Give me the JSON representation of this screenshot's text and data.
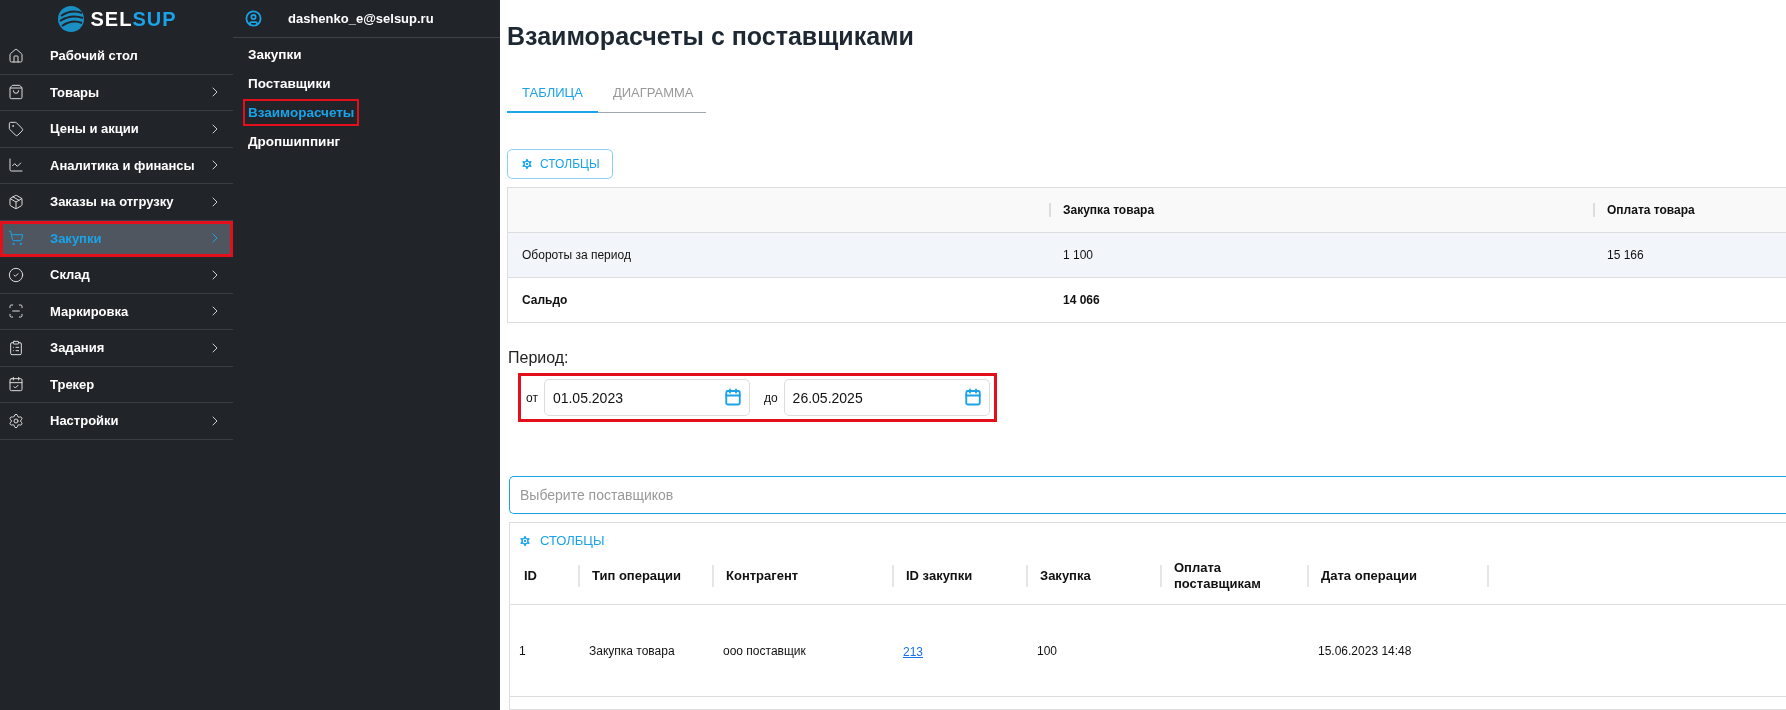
{
  "logo": {
    "part_1": "SEL",
    "part_2": "SUP"
  },
  "sidebar": {
    "items": [
      {
        "label": "Рабочий стол",
        "has_submenu": false,
        "selected": false,
        "highlighted": false
      },
      {
        "label": "Товары",
        "has_submenu": true,
        "selected": false,
        "highlighted": false
      },
      {
        "label": "Цены и акции",
        "has_submenu": true,
        "selected": false,
        "highlighted": false
      },
      {
        "label": "Аналитика и финансы",
        "has_submenu": true,
        "selected": false,
        "highlighted": false
      },
      {
        "label": "Заказы на отгрузку",
        "has_submenu": true,
        "selected": false,
        "highlighted": false
      },
      {
        "label": "Закупки",
        "has_submenu": true,
        "selected": true,
        "highlighted": true
      },
      {
        "label": "Склад",
        "has_submenu": true,
        "selected": false,
        "highlighted": false
      },
      {
        "label": "Маркировка",
        "has_submenu": true,
        "selected": false,
        "highlighted": false
      },
      {
        "label": "Задания",
        "has_submenu": true,
        "selected": false,
        "highlighted": false
      },
      {
        "label": "Трекер",
        "has_submenu": false,
        "selected": false,
        "highlighted": false
      },
      {
        "label": "Настройки",
        "has_submenu": true,
        "selected": false,
        "highlighted": false
      }
    ]
  },
  "submenu": {
    "user": "dashenko_e@selsup.ru",
    "items": [
      {
        "label": "Закупки",
        "selected": false,
        "highlighted": false
      },
      {
        "label": "Поставщики",
        "selected": false,
        "highlighted": false
      },
      {
        "label": "Взаиморасчеты",
        "selected": true,
        "highlighted": true
      },
      {
        "label": "Дропшиппинг",
        "selected": false,
        "highlighted": false
      }
    ]
  },
  "page_title": "Взаиморасчеты с поставщиками",
  "tabs": [
    {
      "label": "ТАБЛИЦА",
      "selected": true
    },
    {
      "label": "ДИАГРАММА",
      "selected": false
    }
  ],
  "columns_button": "СТОЛБЦЫ",
  "summary": {
    "columns": [
      "Закупка товара",
      "Оплата товара"
    ],
    "rows": [
      {
        "kind": "turnover",
        "label": "Обороты за период",
        "values": [
          "1 100",
          "15 166"
        ]
      },
      {
        "kind": "balance",
        "label": "Сальдо",
        "values": [
          "14 066"
        ]
      }
    ]
  },
  "period": {
    "label": "Период:",
    "highlighted": true,
    "from_label": "от",
    "from": "01.05.2023",
    "to_label": "до",
    "to": "26.05.2025"
  },
  "supplier_select": {
    "placeholder": "Выберите поставщиков"
  },
  "operations": {
    "columns_button": "СТОЛБЦЫ",
    "columns": [
      "ID",
      "Тип операции",
      "Контрагент",
      "ID закупки",
      "Закупка",
      "Оплата поставщикам",
      "Дата операции"
    ],
    "rows": [
      {
        "cells": [
          {
            "kind": "text",
            "text": "1"
          },
          {
            "kind": "text",
            "text": "Закупка товара"
          },
          {
            "kind": "text",
            "text": "ооо поставщик"
          },
          {
            "kind": "link",
            "text": "213"
          },
          {
            "kind": "text",
            "text": "100"
          },
          null,
          {
            "kind": "text",
            "text": "15.06.2023 14:48"
          }
        ]
      }
    ]
  }
}
